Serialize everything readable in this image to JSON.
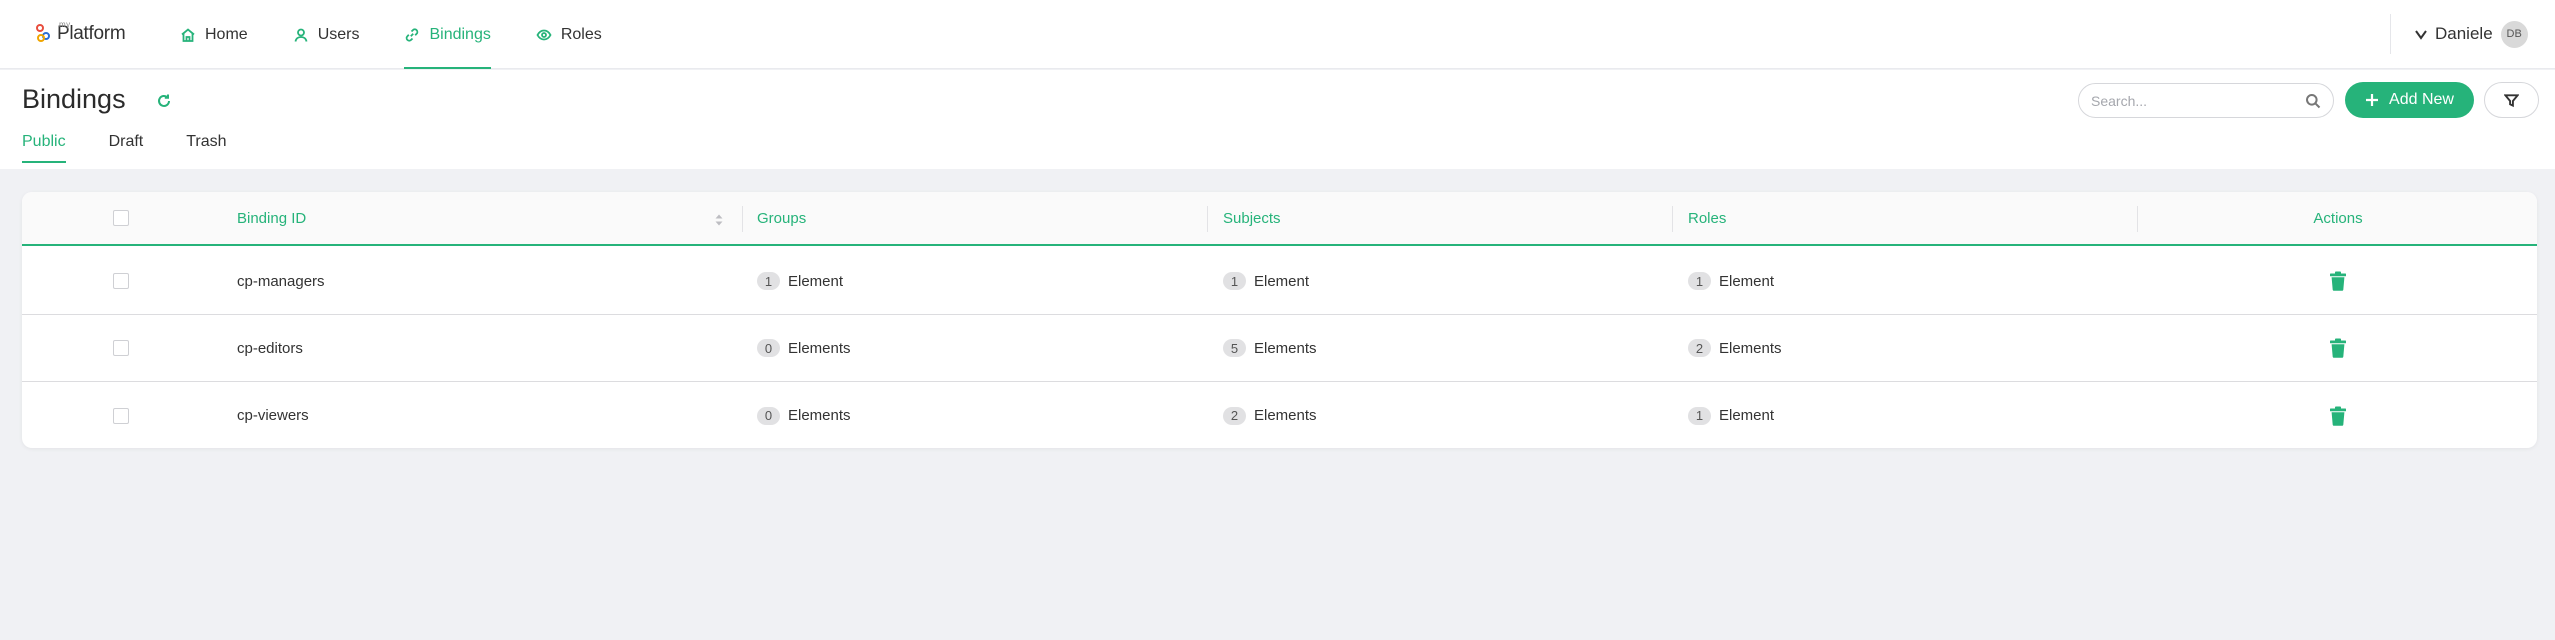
{
  "app": {
    "logo_small": "my",
    "logo_text": "Platform"
  },
  "nav": {
    "items": [
      {
        "label": "Home",
        "icon": "home-icon"
      },
      {
        "label": "Users",
        "icon": "user-icon"
      },
      {
        "label": "Bindings",
        "icon": "link-icon",
        "active": true
      },
      {
        "label": "Roles",
        "icon": "eye-icon"
      }
    ]
  },
  "user": {
    "name": "Daniele",
    "initials": "DB"
  },
  "page": {
    "title": "Bindings",
    "tabs": [
      {
        "label": "Public",
        "active": true
      },
      {
        "label": "Draft"
      },
      {
        "label": "Trash"
      }
    ],
    "search_placeholder": "Search...",
    "add_label": "Add New"
  },
  "table": {
    "headers": {
      "binding_id": "Binding ID",
      "groups": "Groups",
      "subjects": "Subjects",
      "roles": "Roles",
      "actions": "Actions"
    },
    "rows": [
      {
        "binding_id": "cp-managers",
        "groups": {
          "count": "1",
          "label": "Element"
        },
        "subjects": {
          "count": "1",
          "label": "Element"
        },
        "roles": {
          "count": "1",
          "label": "Element"
        }
      },
      {
        "binding_id": "cp-editors",
        "groups": {
          "count": "0",
          "label": "Elements"
        },
        "subjects": {
          "count": "5",
          "label": "Elements"
        },
        "roles": {
          "count": "2",
          "label": "Elements"
        }
      },
      {
        "binding_id": "cp-viewers",
        "groups": {
          "count": "0",
          "label": "Elements"
        },
        "subjects": {
          "count": "2",
          "label": "Elements"
        },
        "roles": {
          "count": "1",
          "label": "Element"
        }
      }
    ]
  },
  "colors": {
    "accent": "#26b37a",
    "background": "#f0f1f4"
  }
}
